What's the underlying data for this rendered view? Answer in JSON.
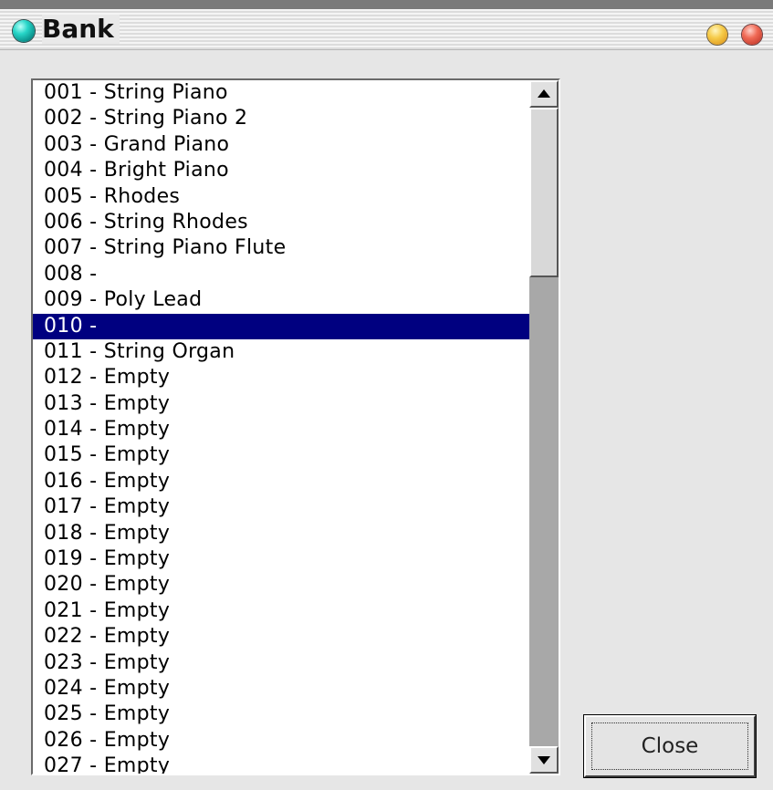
{
  "window": {
    "title": "Bank",
    "title_icon": "teal-orb-icon",
    "buttons": {
      "minimize_icon": "yellow-orb-icon",
      "close_icon": "red-orb-icon"
    }
  },
  "bank_list": {
    "selected_index": 9,
    "selection_color": "#000080",
    "items": [
      "001 - String Piano",
      "002 - String Piano 2",
      "003 - Grand Piano",
      "004 - Bright Piano",
      "005 - Rhodes",
      "006 - String Rhodes",
      "007 - String Piano Flute",
      "008 -",
      "009 - Poly Lead",
      "010 -",
      "011 - String Organ",
      "012 - Empty",
      "013 - Empty",
      "014 - Empty",
      "015 - Empty",
      "016 - Empty",
      "017 - Empty",
      "018 - Empty",
      "019 - Empty",
      "020 - Empty",
      "021 - Empty",
      "022 - Empty",
      "023 - Empty",
      "024 - Empty",
      "025 - Empty",
      "026 - Empty",
      "027 - Empty"
    ]
  },
  "scrollbar": {
    "up_icon": "arrow-up-icon",
    "down_icon": "arrow-down-icon"
  },
  "actions": {
    "close_label": "Close"
  }
}
